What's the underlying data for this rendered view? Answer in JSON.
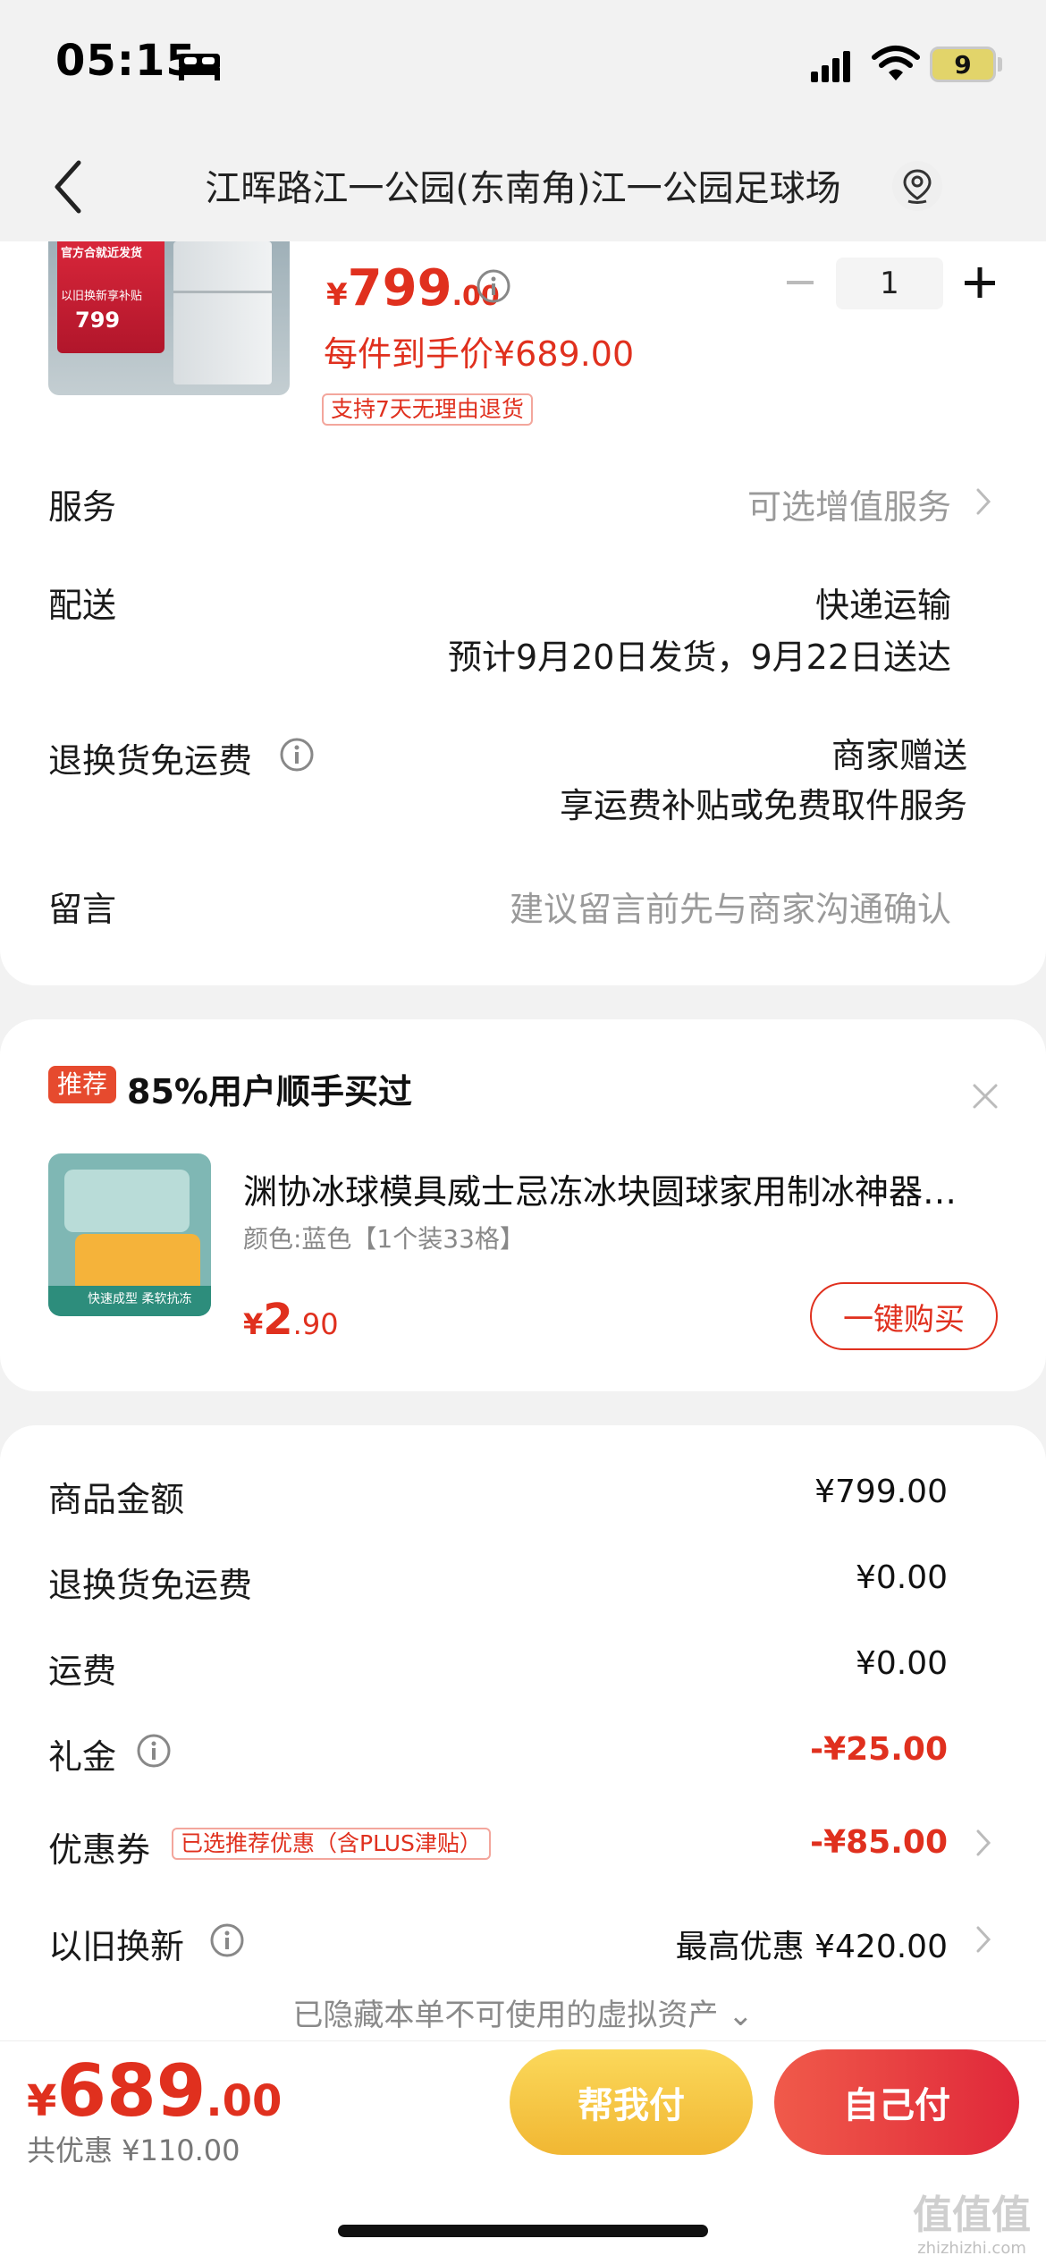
{
  "status_bar": {
    "time": "05:15",
    "battery": "9"
  },
  "nav": {
    "title": "江晖路江一公园(东南角)江一公园足球场"
  },
  "product": {
    "image_promo_line1": "官方合就近发货",
    "image_promo_line2": "以旧换新享补贴",
    "image_promo_price": "799",
    "price_symbol": "¥",
    "price_int": "799",
    "price_dec": ".00",
    "quantity": "1",
    "each_price": "每件到手价¥689.00",
    "return_tag": "支持7天无理由退货"
  },
  "rows": {
    "service_label": "服务",
    "service_value": "可选增值服务",
    "delivery_label": "配送",
    "delivery_method": "快递运输",
    "delivery_eta": "预计9月20日发货，9月22日送达",
    "return_label": "退换货免运费",
    "return_value1": "商家赠送",
    "return_value2": "享运费补贴或免费取件服务",
    "message_label": "留言",
    "message_placeholder": "建议留言前先与商家沟通确认"
  },
  "recommend": {
    "badge": "推荐",
    "text": "85%用户顺手买过",
    "image_caption": "快速成型 柔软抗冻",
    "title": "渊协冰球模具威士忌冻冰块圆球家用制冰神器…",
    "spec": "颜色:蓝色【1个装33格】",
    "price_symbol": "¥",
    "price_int": "2",
    "price_dec": ".90",
    "buy_label": "一键购买"
  },
  "summary": {
    "goods_label": "商品金额",
    "goods_value": "¥799.00",
    "return_fee_label": "退换货免运费",
    "return_fee_value": "¥0.00",
    "shipping_label": "运费",
    "shipping_value": "¥0.00",
    "gift_label": "礼金",
    "gift_value": "-¥25.00",
    "coupon_label": "优惠券",
    "coupon_tag": "已选推荐优惠（含PLUS津贴）",
    "coupon_value": "-¥85.00",
    "tradein_label": "以旧换新",
    "tradein_value": "最高优惠 ¥420.00",
    "hidden_assets": "已隐藏本单不可使用的虚拟资产 ⌄"
  },
  "bottom": {
    "total_symbol": "¥",
    "total_int": "689",
    "total_dec": ".00",
    "saved": "共优惠 ¥110.00",
    "help_pay": "帮我付",
    "self_pay": "自己付"
  },
  "watermark": {
    "main": "值值值",
    "sub": "zhizhizhi.com"
  },
  "colors": {
    "accent_red": "#e0301e",
    "help_yellow": "#f5c842",
    "self_red": "#e8363d"
  }
}
